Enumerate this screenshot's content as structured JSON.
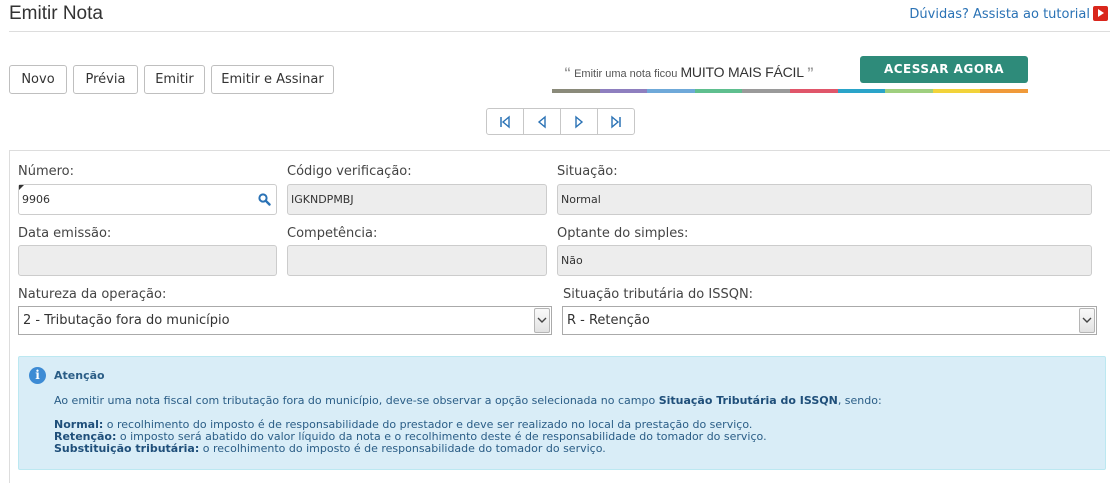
{
  "header": {
    "title": "Emitir Nota",
    "tutorial_link": "Dúvidas? Assista ao tutorial",
    "tutorial_icon": "youtube-play-icon"
  },
  "toolbar": {
    "novo": "Novo",
    "previa": "Prévia",
    "emitir": "Emitir",
    "emitir_assinar": "Emitir e Assinar"
  },
  "promo": {
    "text": "Emitir uma nota ficou",
    "emphasis": "MUITO MAIS FÁCIL",
    "open_quote": "“",
    "close_quote": "”",
    "button": "ACESSAR AGORA",
    "bar_colors": [
      "#8a8a7a",
      "#8e7fbf",
      "#6fa9d9",
      "#5fbf8f",
      "#9a9a9a",
      "#e0566a",
      "#2aa4c9",
      "#9fcf7f",
      "#f2d33a",
      "#f09a3a"
    ]
  },
  "pager": {
    "icons": [
      "first-page-icon",
      "previous-page-icon",
      "next-page-icon",
      "last-page-icon"
    ]
  },
  "form": {
    "numero": {
      "label": "Número:",
      "value": "9906"
    },
    "codigo": {
      "label": "Código verificação:",
      "value": "IGKNDPMBJ"
    },
    "situacao": {
      "label": "Situação:",
      "value": "Normal"
    },
    "data_emissao": {
      "label": "Data emissão:",
      "value": ""
    },
    "competencia": {
      "label": "Competência:",
      "value": ""
    },
    "optante": {
      "label": "Optante do simples:",
      "value": "Não"
    },
    "natureza": {
      "label": "Natureza da operação:",
      "value": "2 - Tributação fora do município"
    },
    "situacao_issqn": {
      "label": "Situação tributária do ISSQN:",
      "value": "R - Retenção"
    }
  },
  "alert": {
    "title": "Atenção",
    "text_before": "Ao emitir uma nota fiscal com tributação fora do município, deve-se observar a opção selecionada no campo",
    "text_bold": "Situação Tributária do ISSQN",
    "text_after": ", sendo:",
    "items": [
      {
        "term": "Normal:",
        "desc": " o recolhimento do imposto é de responsabilidade do prestador e deve ser realizado no local da prestação do serviço."
      },
      {
        "term": "Retenção:",
        "desc": " o imposto será abatido do valor líquido da nota e o recolhimento deste é de responsabilidade do tomador do serviço."
      },
      {
        "term": "Substituição tributária:",
        "desc": " o recolhimento do imposto é de responsabilidade do tomador do serviço."
      }
    ]
  }
}
